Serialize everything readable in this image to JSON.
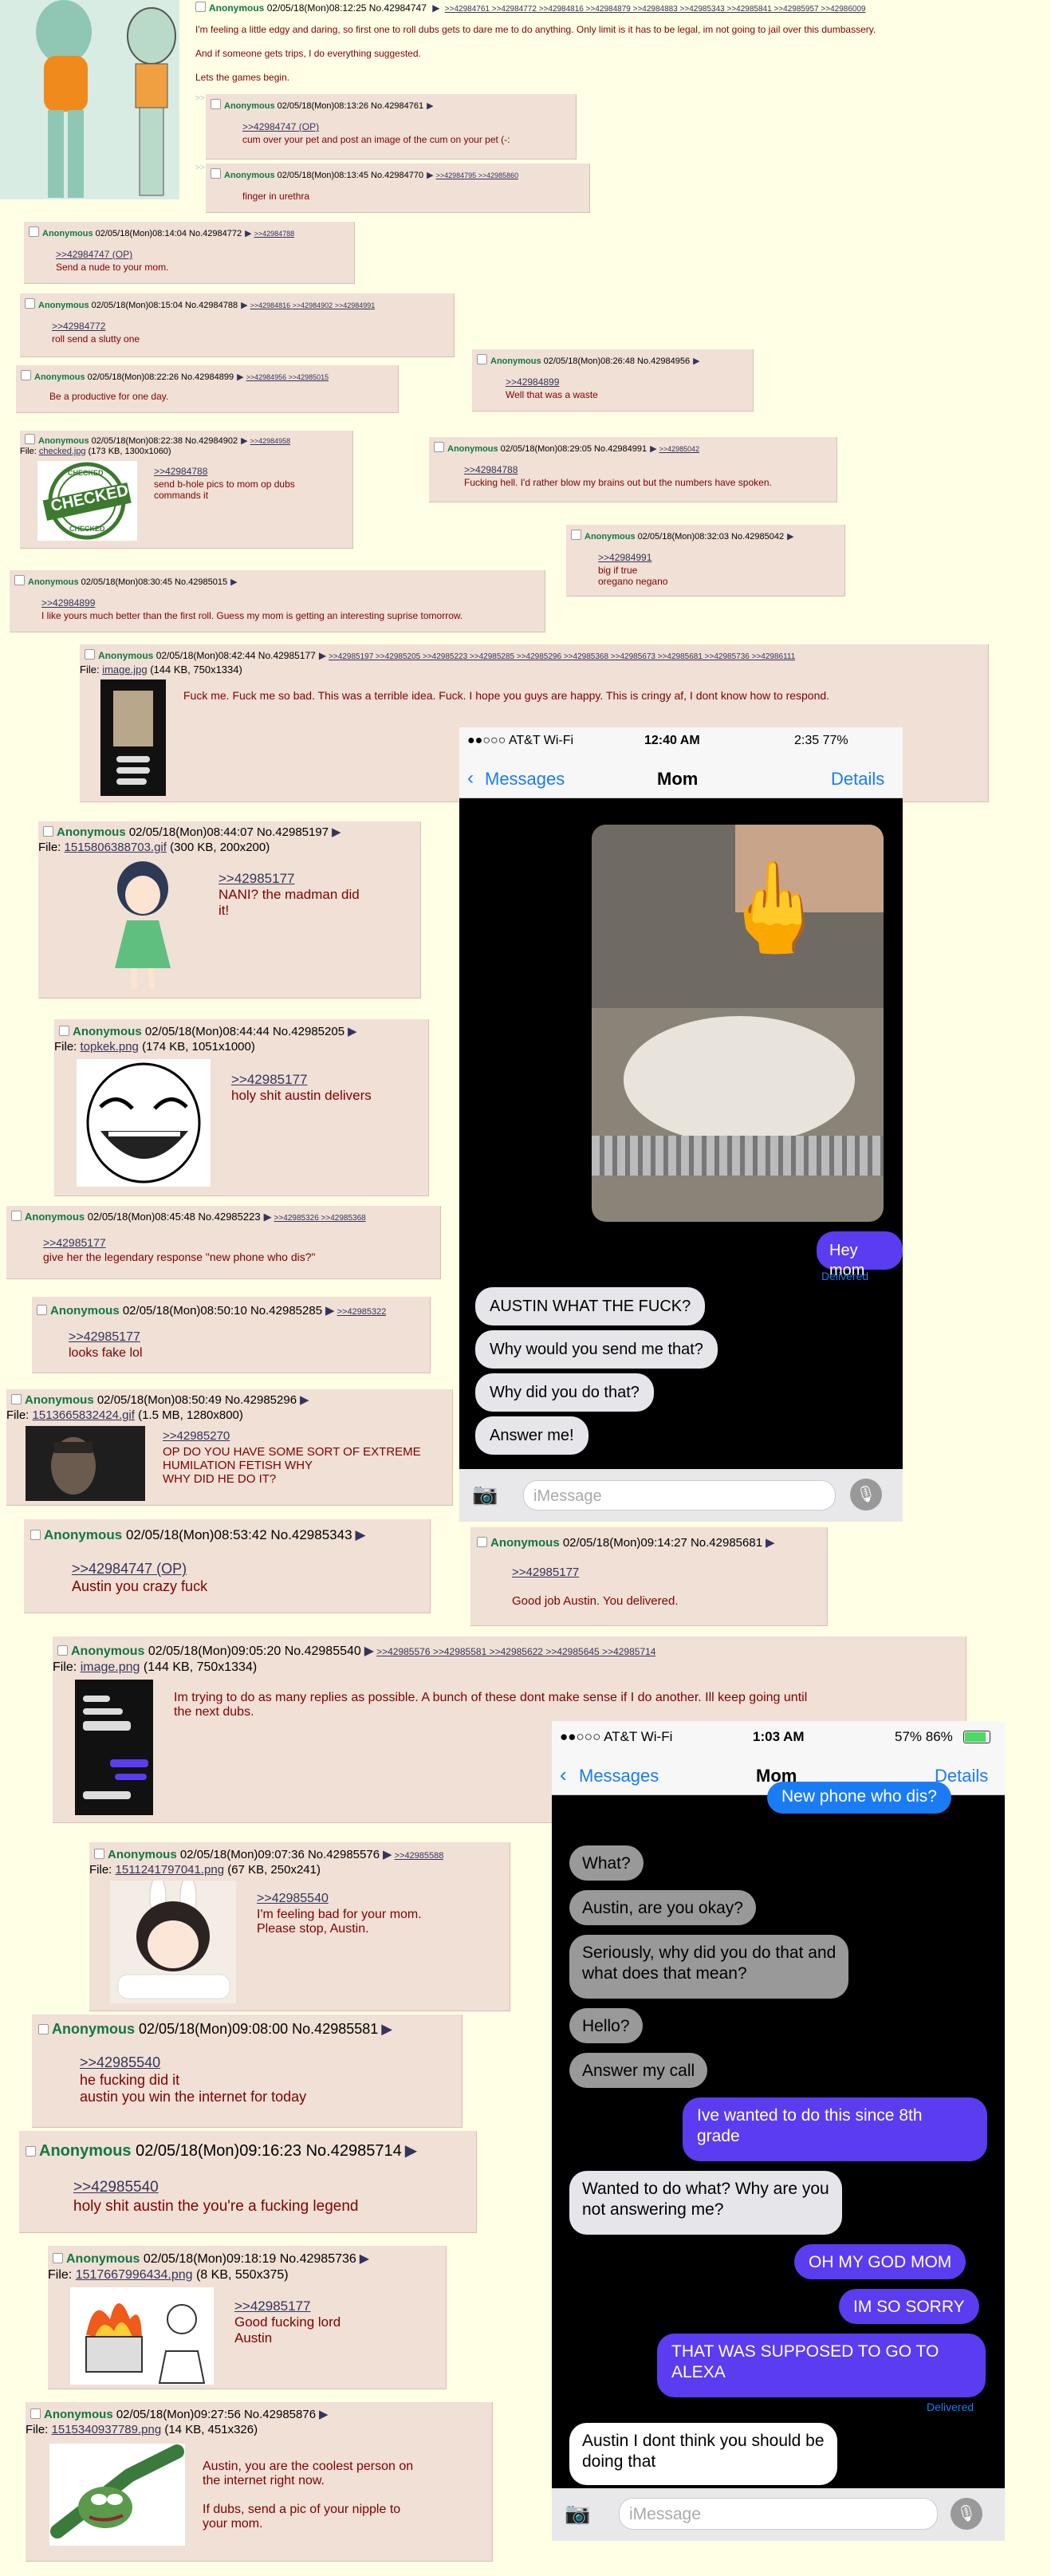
{
  "op": {
    "name": "Anonymous",
    "datetime": "02/05/18(Mon)08:12:25",
    "no": "No.42984747",
    "refs": ">>42984761 >>42984772 >>42984816 >>42984879 >>42984883 >>42985343 >>42985841 >>42985957 >>42986009",
    "text1": "I'm feeling a little edgy and daring, so first one to roll dubs gets to dare me to do anything. Only limit is it has to be legal, im not going to jail over this dumbassery.",
    "text2": "And if someone gets trips, I do everything suggested.",
    "text3": "Lets the games begin."
  },
  "posts": {
    "p1": {
      "name": "Anonymous",
      "head": "02/05/18(Mon)08:13:26 No.42984761",
      "quote": ">>42984747 (OP)",
      "text": "cum over your pet and post an image of the cum on your pet (-:"
    },
    "p2": {
      "name": "Anonymous",
      "head": "02/05/18(Mon)08:13:45 No.42984770",
      "refs": ">>42984795 >>42985860",
      "text": "finger in urethra"
    },
    "p3": {
      "name": "Anonymous",
      "head": "02/05/18(Mon)08:14:04 No.42984772",
      "refs": ">>42984788",
      "quote": ">>42984747 (OP)",
      "text": "Send a nude to your mom."
    },
    "p4": {
      "name": "Anonymous",
      "head": "02/05/18(Mon)08:15:04 No.42984788",
      "refs": ">>42984816 >>42984902 >>42984991",
      "quote": ">>42984772",
      "text": "roll send a slutty one"
    },
    "p5": {
      "name": "Anonymous",
      "head": "02/05/18(Mon)08:22:26 No.42984899",
      "refs": ">>42984956 >>42985015",
      "text": "Be a productive for one day."
    },
    "p6": {
      "name": "Anonymous",
      "head": "02/05/18(Mon)08:26:48 No.42984956",
      "quote": ">>42984899",
      "text": "Well that was a waste"
    },
    "p7": {
      "name": "Anonymous",
      "head": "02/05/18(Mon)08:22:38 No.42984902",
      "refs": ">>42984958",
      "file_label": "File:",
      "file_name": "checked.jpg",
      "file_meta": "(173 KB, 1300x1060)",
      "quote": ">>42984788",
      "text": "send b-hole pics to mom op dubs\ncommands it",
      "stamp_top": "CHECKED",
      "stamp_mid": "CHECKED",
      "stamp_bot": "CHECKED"
    },
    "p8": {
      "name": "Anonymous",
      "head": "02/05/18(Mon)08:29:05 No.42984991",
      "refs": ">>42985042",
      "quote": ">>42984788",
      "text": "Fucking hell. I'd rather blow my brains out but the numbers have spoken."
    },
    "p9": {
      "name": "Anonymous",
      "head": "02/05/18(Mon)08:32:03 No.42985042",
      "quote": ">>42984991",
      "text": "big if true\noregano negano"
    },
    "p10": {
      "name": "Anonymous",
      "head": "02/05/18(Mon)08:30:45 No.42985015",
      "quote": ">>42984899",
      "text": "I like yours much better than the first roll. Guess my mom is getting an interesting suprise tomorrow."
    },
    "p11": {
      "name": "Anonymous",
      "head": "02/05/18(Mon)08:42:44 No.42985177",
      "refs": ">>42985197 >>42985205 >>42985223 >>42985285 >>42985296 >>42985368 >>42985673 >>42985681 >>42985736 >>42986111",
      "file_label": "File:",
      "file_name": "image.jpg",
      "file_meta": "(144 KB, 750x1334)",
      "text": "Fuck me. Fuck me so bad. This was a terrible idea. Fuck. I hope you guys are happy. This is cringy af, I dont know how to respond."
    },
    "p12": {
      "name": "Anonymous",
      "head": "02/05/18(Mon)08:44:07 No.42985197",
      "file_label": "File:",
      "file_name": "1515806388703.gif",
      "file_meta": "(300 KB, 200x200)",
      "quote": ">>42985177",
      "text": "NANI? the madman did\nit!"
    },
    "p13": {
      "name": "Anonymous",
      "head": "02/05/18(Mon)08:44:44 No.42985205",
      "file_label": "File:",
      "file_name": "topkek.png",
      "file_meta": "(174 KB, 1051x1000)",
      "quote": ">>42985177",
      "text": "holy shit austin delivers"
    },
    "p14": {
      "name": "Anonymous",
      "head": "02/05/18(Mon)08:45:48 No.42985223",
      "refs": ">>42985326 >>42985368",
      "quote": ">>42985177",
      "text": "give her the legendary response \"new phone who dis?\""
    },
    "p15": {
      "name": "Anonymous",
      "head": "02/05/18(Mon)08:50:10 No.42985285",
      "refs": ">>42985322",
      "quote": ">>42985177",
      "text": "looks fake lol"
    },
    "p16": {
      "name": "Anonymous",
      "head": "02/05/18(Mon)08:50:49 No.42985296",
      "file_label": "File:",
      "file_name": "1513665832424.gif",
      "file_meta": "(1.5 MB, 1280x800)",
      "quote": ">>42985270",
      "text": "OP DO YOU HAVE SOME SORT OF EXTREME\nHUMILATION FETISH WHY\nWHY DID HE DO IT?"
    },
    "p17": {
      "name": "Anonymous",
      "head": "02/05/18(Mon)08:53:42 No.42985343",
      "quote": ">>42984747 (OP)",
      "text": "Austin you crazy fuck"
    },
    "p18": {
      "name": "Anonymous",
      "head": "02/05/18(Mon)09:14:27 No.42985681",
      "quote": ">>42985177",
      "text": "Good job Austin. You delivered."
    },
    "p19": {
      "name": "Anonymous",
      "head": "02/05/18(Mon)09:05:20 No.42985540",
      "refs": ">>42985576 >>42985581 >>42985622 >>42985645 >>42985714",
      "file_label": "File:",
      "file_name": "image.png",
      "file_meta": "(144 KB, 750x1334)",
      "text": "Im trying to do as many replies as possible. A bunch of these dont make sense if I do another. Ill keep going until\nthe next dubs."
    },
    "p20": {
      "name": "Anonymous",
      "head": "02/05/18(Mon)09:07:36 No.42985576",
      "refs": ">>42985588",
      "file_label": "File:",
      "file_name": "1511241797041.png",
      "file_meta": "(67 KB, 250x241)",
      "quote": ">>42985540",
      "text": "I'm feeling bad for your mom.\nPlease stop, Austin."
    },
    "p21": {
      "name": "Anonymous",
      "head": "02/05/18(Mon)09:08:00 No.42985581",
      "quote": ">>42985540",
      "text": "he fucking did it\naustin you win the internet for today"
    },
    "p22": {
      "name": "Anonymous",
      "head": "02/05/18(Mon)09:16:23 No.42985714",
      "quote": ">>42985540",
      "text": "holy shit austin the you're a fucking legend"
    },
    "p23": {
      "name": "Anonymous",
      "head": "02/05/18(Mon)09:18:19 No.42985736",
      "file_label": "File:",
      "file_name": "1517667996434.png",
      "file_meta": "(8 KB, 550x375)",
      "quote": ">>42985177",
      "text": "Good fucking lord\nAustin"
    },
    "p24": {
      "name": "Anonymous",
      "head": "02/05/18(Mon)09:27:56 No.42985876",
      "file_label": "File:",
      "file_name": "1515340937789.png",
      "file_meta": "(14 KB, 451x326)",
      "text": "Austin, you are the coolest person on\nthe internet right now.\n\nIf dubs, send a pic of your nipple to\nyour mom."
    }
  },
  "phone1": {
    "carrier": "●●○○○ AT&T Wi-Fi",
    "time": "12:40 AM",
    "battery": "2:35 77%",
    "back": "Messages",
    "title": "Mom",
    "details": "Details",
    "sent": "Hey mom",
    "delivered": "Delivered",
    "replies": [
      "AUSTIN WHAT THE FUCK?",
      "Why would you send me that?",
      "Why did you do that?",
      "Answer me!"
    ],
    "placeholder": "iMessage"
  },
  "phone2": {
    "carrier": "●●○○○ AT&T Wi-Fi",
    "time": "1:03 AM",
    "battery": "57% 86%",
    "back": "Messages",
    "title": "Mom",
    "details": "Details",
    "top": "New phone who dis?",
    "m1": "What?",
    "m2": "Austin, are you okay?",
    "m3": "Seriously, why did you do that and\nwhat does that mean?",
    "m4": "Hello?",
    "m5": "Answer my call",
    "s1": "Ive wanted to do this since 8th\ngrade",
    "m6": "Wanted to do what? Why are you\nnot answering me?",
    "s2": "OH MY GOD MOM",
    "s3": "IM SO SORRY",
    "s4": "THAT WAS SUPPOSED TO GO TO\nALEXA",
    "delivered": "Delivered",
    "m7": "Austin I dont think you should be\ndoing that",
    "placeholder": "iMessage"
  },
  "colors": {
    "name": "#117743",
    "post_bg": "#f0e0d6",
    "link": "#34345c",
    "text": "#800000",
    "imessage_purple": "#5b3cf0",
    "ios_blue": "#1a7cf5"
  }
}
